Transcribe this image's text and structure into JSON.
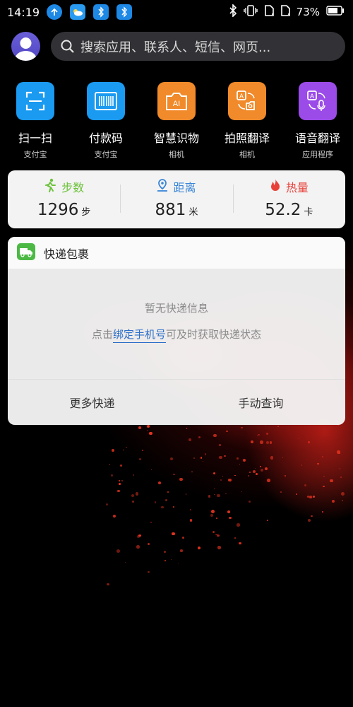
{
  "status_bar": {
    "time": "14:19",
    "battery": "73%",
    "icons": [
      "upload-icon",
      "weather-icon",
      "bluetooth-app-icon",
      "bluetooth-app-icon",
      "bluetooth-icon",
      "vibrate-icon",
      "no-sim-icon",
      "no-sim-icon",
      "battery-icon"
    ]
  },
  "search": {
    "placeholder": "搜索应用、联系人、短信、网页..."
  },
  "apps": [
    {
      "name": "扫一扫",
      "sub": "支付宝",
      "icon": "scan-icon",
      "color": "#1a9af0"
    },
    {
      "name": "付款码",
      "sub": "支付宝",
      "icon": "barcode-icon",
      "color": "#1a9af0"
    },
    {
      "name": "智慧识物",
      "sub": "相机",
      "icon": "ai-camera-icon",
      "color": "#f08a2a"
    },
    {
      "name": "拍照翻译",
      "sub": "相机",
      "icon": "photo-translate-icon",
      "color": "#f08a2a"
    },
    {
      "name": "语音翻译",
      "sub": "应用程序",
      "icon": "voice-translate-icon",
      "color": "#9b4ce8"
    }
  ],
  "stats": [
    {
      "label": "步数",
      "value": "1296",
      "unit": "步",
      "icon": "running-icon",
      "color": "#6cc23a"
    },
    {
      "label": "距离",
      "value": "881",
      "unit": "米",
      "icon": "location-icon",
      "color": "#3a86d8"
    },
    {
      "label": "热量",
      "value": "52.2",
      "unit": "卡",
      "icon": "flame-icon",
      "color": "#e8413a"
    }
  ],
  "express": {
    "title": "快递包裹",
    "icon": "delivery-truck-icon",
    "empty": "暂无快递信息",
    "hint_prefix": "点击",
    "hint_link": "绑定手机号",
    "hint_suffix": "可及时获取快递状态",
    "more": "更多快递",
    "manual": "手动查询"
  }
}
